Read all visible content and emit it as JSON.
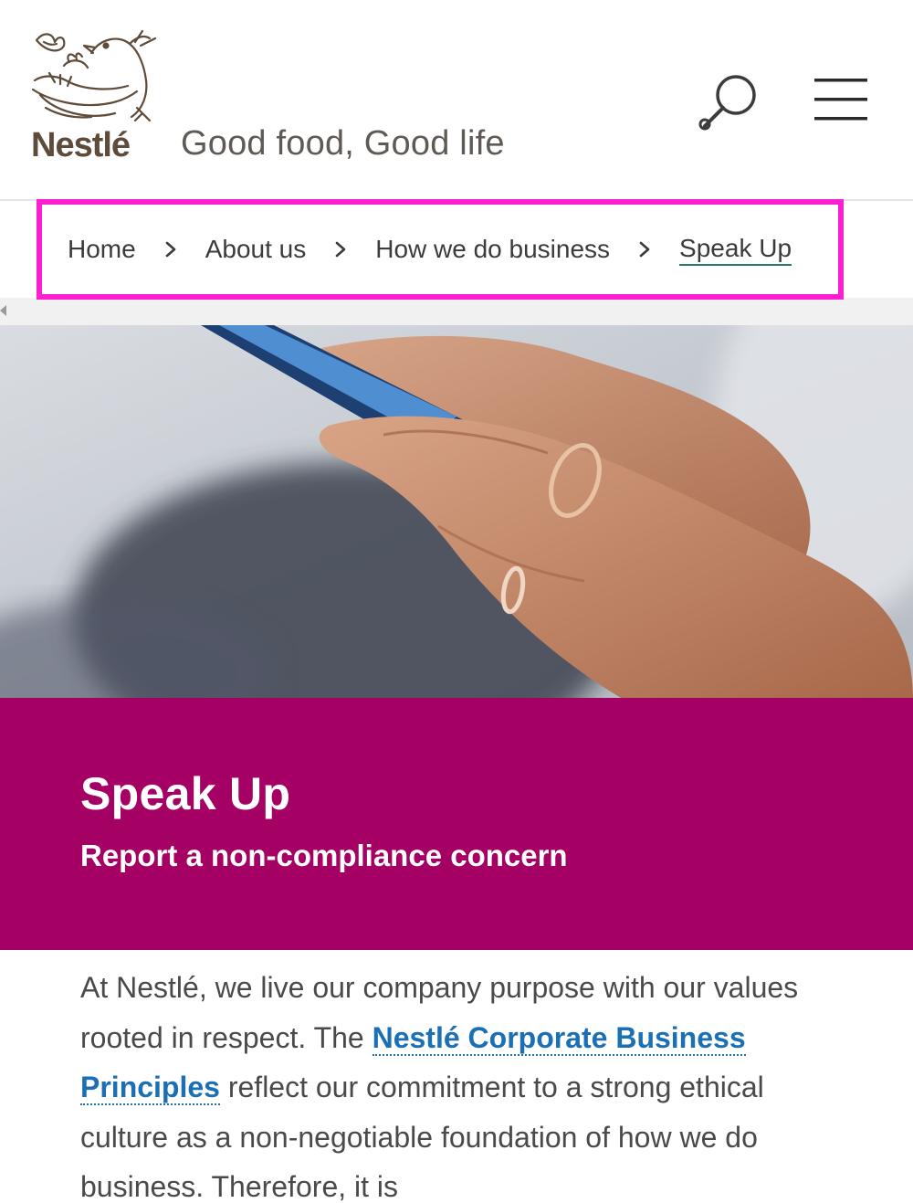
{
  "header": {
    "brand": "Nestlé",
    "tagline": "Good food, Good life",
    "search_icon": "search-icon",
    "menu_icon": "hamburger-menu-icon"
  },
  "breadcrumb": {
    "items": [
      {
        "label": "Home"
      },
      {
        "label": "About us"
      },
      {
        "label": "How we do business"
      },
      {
        "label": "Speak Up"
      }
    ],
    "separator_icon": "chevron-right-icon"
  },
  "banner": {
    "title": "Speak Up",
    "subtitle": "Report a non-compliance concern"
  },
  "body": {
    "text_before": "At Nestlé, we live our company purpose with our values rooted in respect. The ",
    "link_text": "Nestlé Corporate Business Principles",
    "text_after": " reflect our commitment to a strong ethical culture as a non-negotiable foundation of how we do business. Therefore, it is"
  },
  "colors": {
    "banner": "#a50063",
    "link": "#1a6fb5",
    "highlight_border": "#ff1fd2",
    "text": "#4a4a4a"
  }
}
